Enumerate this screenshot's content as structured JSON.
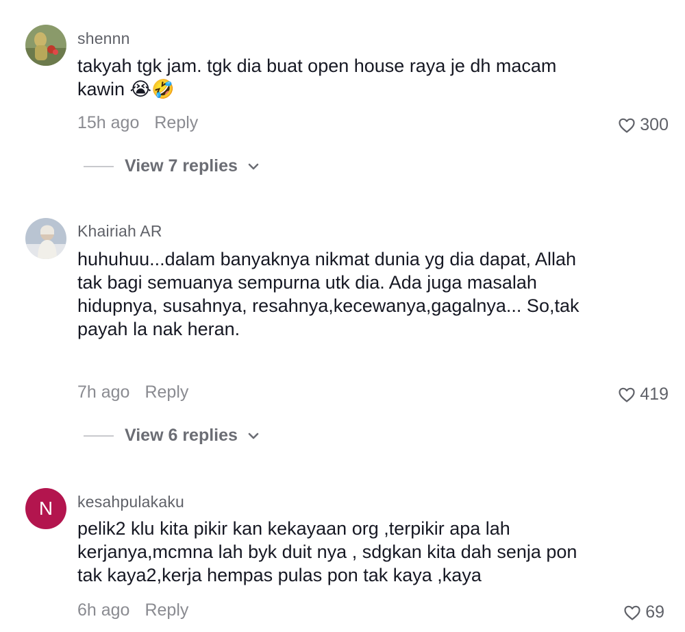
{
  "comments": [
    {
      "username": "shennn",
      "text": "takyah tgk jam. tgk dia buat open house raya je dh macam kawin 😭🤣",
      "time": "15h ago",
      "reply_label": "Reply",
      "likes": "300",
      "view_replies": "View 7 replies"
    },
    {
      "username": "Khairiah AR",
      "text": "huhuhuu...dalam banyaknya nikmat dunia yg dia dapat, Allah tak bagi semuanya sempurna utk dia. Ada juga masalah hidupnya, susahnya, resahnya,kecewanya,gagalnya... So,tak payah la nak heran.",
      "time": "7h ago",
      "reply_label": "Reply",
      "likes": "419",
      "view_replies": "View 6 replies"
    },
    {
      "username": "kesahpulakaku",
      "avatar_letter": "N",
      "text": "pelik2 klu kita pikir kan kekayaan org ,terpikir apa lah kerjanya,mcmna lah byk duit nya , sdgkan kita dah senja pon tak kaya2,kerja hempas pulas pon tak kaya ,kaya",
      "time": "6h ago",
      "reply_label": "Reply",
      "likes": "69"
    }
  ],
  "icons": {
    "like": "heart-outline-icon",
    "expand": "chevron-down-icon"
  },
  "colors": {
    "avatar_letter_bg": "#b3154e",
    "secondary_text": "#8a8b91"
  }
}
